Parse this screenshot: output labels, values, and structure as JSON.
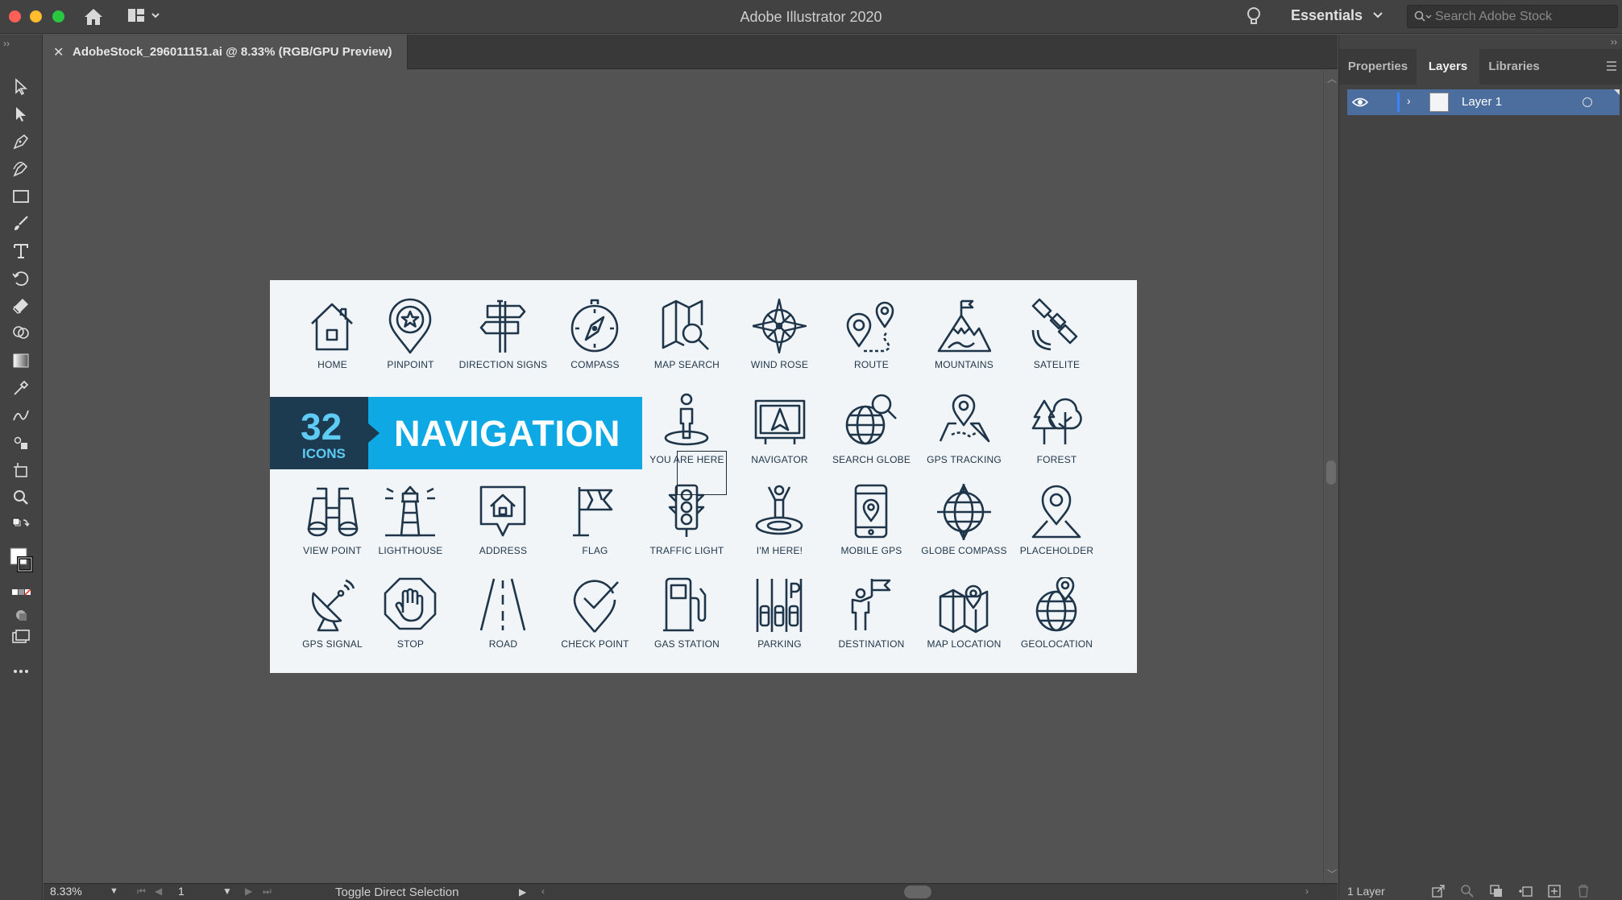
{
  "window": {
    "app_title": "Adobe Illustrator 2020",
    "workspace": "Essentials",
    "stock_search_placeholder": "Search Adobe Stock"
  },
  "document": {
    "tab_title": "AdobeStock_296011151.ai @ 8.33% (RGB/GPU Preview)"
  },
  "status_bar": {
    "zoom": "8.33%",
    "artboard_number": "1",
    "status_text": "Toggle Direct Selection"
  },
  "right_panel": {
    "tabs": [
      "Properties",
      "Layers",
      "Libraries"
    ],
    "active_tab": "Layers",
    "layers": [
      {
        "name": "Layer 1",
        "visible": true
      }
    ],
    "layer_count_text": "1 Layer"
  },
  "artboard": {
    "banner": {
      "number": "32",
      "subtitle": "ICONS",
      "title": "NAVIGATION"
    },
    "icons": [
      {
        "label": "HOME",
        "icon": "home-icon"
      },
      {
        "label": "PINPOINT",
        "icon": "pinpoint-icon"
      },
      {
        "label": "DIRECTION SIGNS",
        "icon": "direction-signs-icon"
      },
      {
        "label": "COMPASS",
        "icon": "compass-icon"
      },
      {
        "label": "MAP SEARCH",
        "icon": "map-search-icon"
      },
      {
        "label": "WIND ROSE",
        "icon": "wind-rose-icon"
      },
      {
        "label": "ROUTE",
        "icon": "route-icon"
      },
      {
        "label": "MOUNTAINS",
        "icon": "mountains-icon"
      },
      {
        "label": "SATELITE",
        "icon": "satellite-icon"
      },
      {
        "label": "YOU ARE HERE",
        "icon": "you-are-here-icon"
      },
      {
        "label": "NAVIGATOR",
        "icon": "navigator-icon"
      },
      {
        "label": "SEARCH GLOBE",
        "icon": "search-globe-icon"
      },
      {
        "label": "GPS TRACKING",
        "icon": "gps-tracking-icon"
      },
      {
        "label": "FOREST",
        "icon": "forest-icon"
      },
      {
        "label": "VIEW POINT",
        "icon": "binoculars-icon"
      },
      {
        "label": "LIGHTHOUSE",
        "icon": "lighthouse-icon"
      },
      {
        "label": "ADDRESS",
        "icon": "address-icon"
      },
      {
        "label": "FLAG",
        "icon": "flag-icon"
      },
      {
        "label": "TRAFFIC LIGHT",
        "icon": "traffic-light-icon"
      },
      {
        "label": "I'M HERE!",
        "icon": "im-here-icon"
      },
      {
        "label": "MOBILE GPS",
        "icon": "mobile-gps-icon"
      },
      {
        "label": "GLOBE COMPASS",
        "icon": "globe-compass-icon"
      },
      {
        "label": "PLACEHOLDER",
        "icon": "placeholder-icon"
      },
      {
        "label": "GPS SIGNAL",
        "icon": "satellite-dish-icon"
      },
      {
        "label": "STOP",
        "icon": "stop-hand-icon"
      },
      {
        "label": "ROAD",
        "icon": "road-icon"
      },
      {
        "label": "CHECK POINT",
        "icon": "check-point-icon"
      },
      {
        "label": "GAS STATION",
        "icon": "gas-station-icon"
      },
      {
        "label": "PARKING",
        "icon": "parking-icon"
      },
      {
        "label": "DESTINATION",
        "icon": "destination-icon"
      },
      {
        "label": "MAP LOCATION",
        "icon": "map-location-icon"
      },
      {
        "label": "GEOLOCATION",
        "icon": "geolocation-icon"
      }
    ]
  },
  "colors": {
    "icon_stroke": "#1f3549",
    "banner_dark": "#1c3b50",
    "banner_blue": "#0ea9e4",
    "banner_accent": "#5ecbf4",
    "artboard_bg": "#f1f5f8",
    "canvas_bg": "#535353",
    "panel_bg": "#434343"
  }
}
